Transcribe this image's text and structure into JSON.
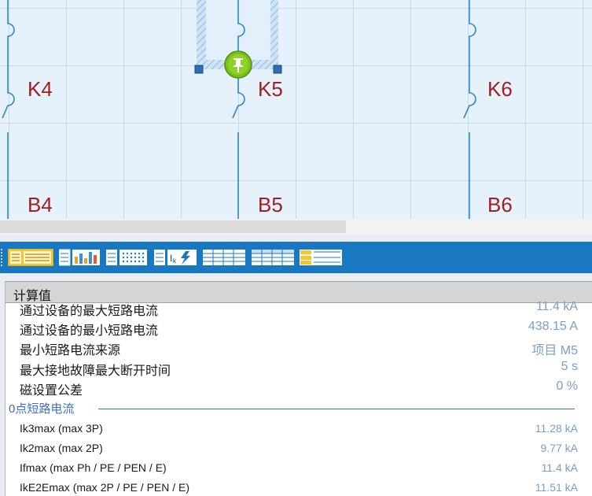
{
  "diagram": {
    "devices": [
      {
        "id": "K4",
        "label": "K4"
      },
      {
        "id": "K5",
        "label": "K5"
      },
      {
        "id": "K6",
        "label": "K6"
      }
    ],
    "buses": [
      {
        "id": "B4",
        "label": "B4"
      },
      {
        "id": "B5",
        "label": "B5"
      },
      {
        "id": "B6",
        "label": "B6"
      }
    ],
    "pin_icon": "pushpin-icon",
    "accent_line": "#2f86cf",
    "label_color": "#a0201f",
    "selection_color": "#2f6fb0"
  },
  "toolbar": {
    "buttons": [
      {
        "name": "view-tree-table-button",
        "icon": "tree-table-icon",
        "active": true
      },
      {
        "name": "view-bar-chart-button",
        "icon": "bar-chart-icon"
      },
      {
        "name": "view-dot-grid-button",
        "icon": "dot-grid-icon"
      },
      {
        "name": "view-short-circuit-button",
        "icon": "short-circuit-icon",
        "text": "Ik"
      },
      {
        "name": "view-grid-a-button",
        "icon": "grid-icon"
      },
      {
        "name": "view-grid-b-button",
        "icon": "grid-icon"
      },
      {
        "name": "view-yellow-list-button",
        "icon": "list-icon"
      }
    ]
  },
  "panel": {
    "header": "计算值",
    "rows": [
      {
        "label": "通过设备的最大短路电流",
        "value": "11.4 kA"
      },
      {
        "label": "通过设备的最小短路电流",
        "value": "438.15 A"
      },
      {
        "label": "最小短路电流来源",
        "value": "项目 M5"
      },
      {
        "label": "最大接地故障最大断开时间",
        "value": "5 s"
      },
      {
        "label": "磁设置公差",
        "value": "0 %"
      }
    ],
    "section": "0点短路电流",
    "section_rows": [
      {
        "label": "Ik3max (max 3P)",
        "value": "11.28 kA"
      },
      {
        "label": "Ik2max (max 2P)",
        "value": "9.77 kA"
      },
      {
        "label": "Ifmax (max Ph / PE / PEN / E)",
        "value": "11.4 kA"
      },
      {
        "label": "IkE2Emax (max 2P / PE / PEN / E)",
        "value": "11.51 kA"
      }
    ]
  }
}
